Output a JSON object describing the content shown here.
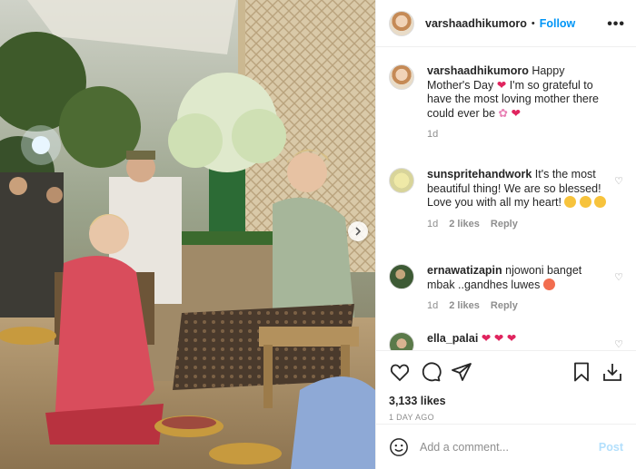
{
  "header": {
    "username": "varshaadhikumoro",
    "separator": "•",
    "follow_label": "Follow",
    "more_label": "•••"
  },
  "caption": {
    "username": "varshaadhikumoro",
    "text": "Happy Mother's Day",
    "text2": "I'm so grateful to have the most loving mother there could ever be",
    "time": "1d"
  },
  "comments": [
    {
      "username": "sunspritehandwork",
      "text": "It's the most beautiful thing! We are so blessed! Love you with all my heart!",
      "time": "1d",
      "likes": "2 likes",
      "reply": "Reply"
    },
    {
      "username": "ernawatizapin",
      "text": "njowoni banget mbak ..gandhes luwes",
      "time": "1d",
      "likes": "2 likes",
      "reply": "Reply"
    },
    {
      "username": "ella_palai",
      "text": ""
    }
  ],
  "post_stats": {
    "likes": "3,133 likes",
    "ago": "1 DAY AGO"
  },
  "add_comment": {
    "placeholder": "Add a comment...",
    "post_label": "Post"
  },
  "icons": {
    "like": "heart-icon",
    "comment": "comment-icon",
    "share": "share-icon",
    "save": "bookmark-icon",
    "download": "download-icon",
    "emoji": "emoji-icon",
    "next": "chevron-right-icon"
  },
  "colors": {
    "accent": "#0095f6",
    "post_disabled": "#b2dffc",
    "secondary_text": "#8e8e8e",
    "heart_emoji": "#e0245e"
  }
}
